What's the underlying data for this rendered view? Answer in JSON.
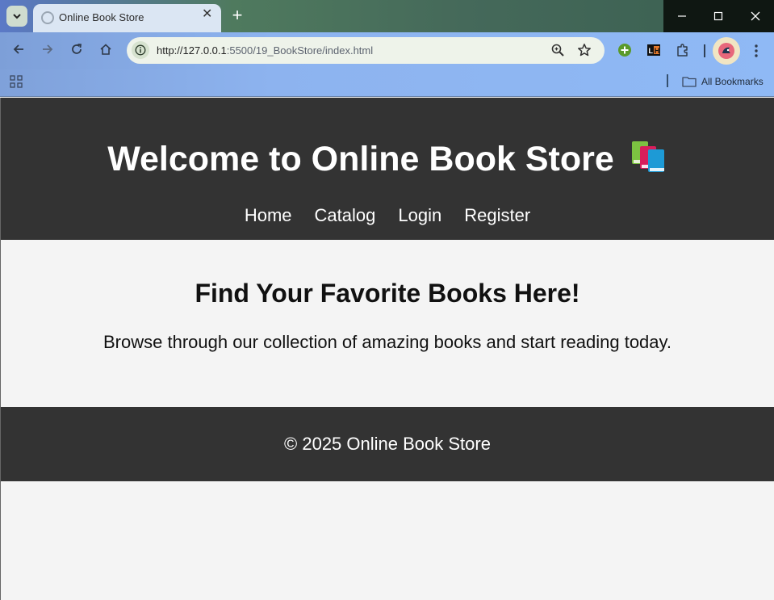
{
  "browser": {
    "tab_title": "Online Book Store",
    "url_host": "http://127.0.0.1",
    "url_rest": ":5500/19_BookStore/index.html",
    "bookmarks_label": "All Bookmarks",
    "new_tab_symbol": "+",
    "tab_close_symbol": "✕"
  },
  "site": {
    "title": "Welcome to Online Book Store",
    "nav": [
      "Home",
      "Catalog",
      "Login",
      "Register"
    ],
    "hero_title": "Find Your Favorite Books Here!",
    "hero_text": "Browse through our collection of amazing books and start reading today.",
    "footer": "© 2025 Online Book Store"
  },
  "colors": {
    "header_bg": "#333333",
    "page_bg": "#f4f4f4",
    "text_light": "#ffffff"
  }
}
